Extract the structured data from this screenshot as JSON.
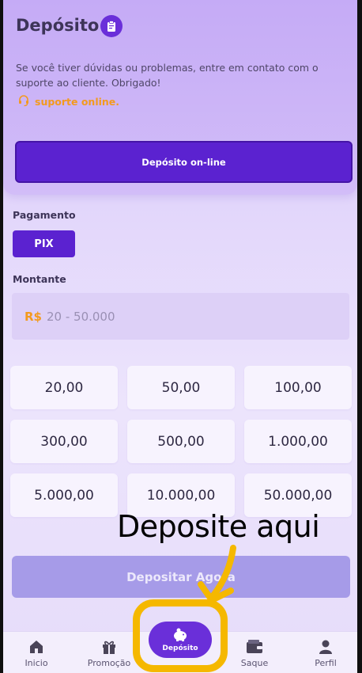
{
  "header": {
    "title": "Depósito",
    "notice": "Se você tiver dúvidas ou problemas, entre em contato com o suporte ao cliente. Obrigado!",
    "support_link": "suporte online.",
    "online_deposit_button": "Depósito on-line"
  },
  "payment": {
    "label": "Pagamento",
    "method": "PIX"
  },
  "amount": {
    "label": "Montante",
    "currency": "R$",
    "range_placeholder": "20 - 50.000",
    "presets": [
      "20,00",
      "50,00",
      "100,00",
      "300,00",
      "500,00",
      "1.000,00",
      "5.000,00",
      "10.000,00",
      "50.000,00"
    ]
  },
  "deposit_button": "Depositar Agora",
  "annotation": {
    "caption": "Deposite aqui"
  },
  "nav": {
    "items": [
      {
        "label": "Inicio",
        "icon": "home-icon"
      },
      {
        "label": "Promoção",
        "icon": "gift-icon"
      },
      {
        "label": "Depósito",
        "icon": "piggy-bank-icon"
      },
      {
        "label": "Saque",
        "icon": "wallet-icon"
      },
      {
        "label": "Perfil",
        "icon": "user-icon"
      }
    ]
  },
  "colors": {
    "primary": "#5b22d0",
    "accent_orange": "#f39a1e",
    "highlight": "#f5b800",
    "disabled_button": "#a69be8"
  }
}
